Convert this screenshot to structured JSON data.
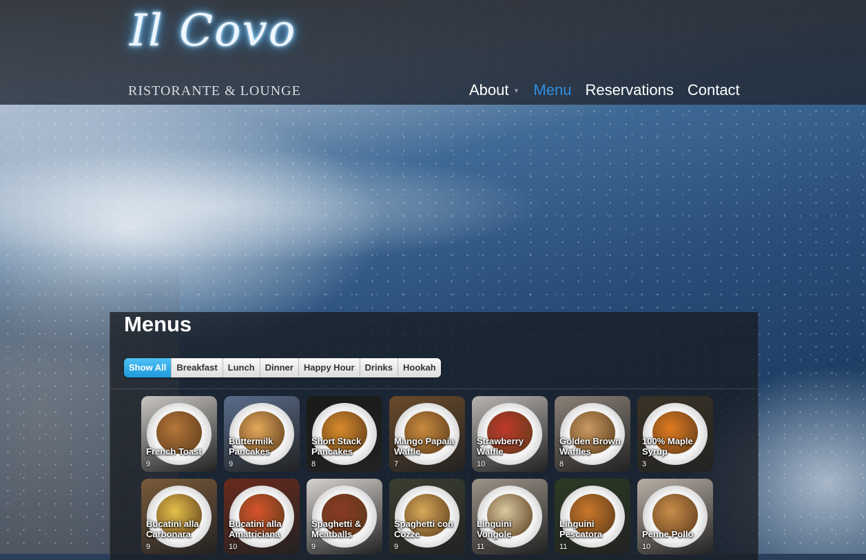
{
  "site": {
    "logo_script": "Il Covo",
    "logo_subtitle": "RISTORANTE & LOUNGE"
  },
  "nav": {
    "items": [
      {
        "label": "About",
        "has_dropdown": true,
        "active": false
      },
      {
        "label": "Menu",
        "has_dropdown": false,
        "active": true
      },
      {
        "label": "Reservations",
        "has_dropdown": false,
        "active": false
      },
      {
        "label": "Contact",
        "has_dropdown": false,
        "active": false
      }
    ]
  },
  "menus": {
    "title": "Menus",
    "filters": [
      "Show All",
      "Breakfast",
      "Lunch",
      "Dinner",
      "Happy Hour",
      "Drinks",
      "Hookah"
    ],
    "active_filter": "Show All",
    "items": [
      {
        "name": "French Toast",
        "count": "9",
        "bg": "#c9c6c2",
        "food": "#b5763a"
      },
      {
        "name": "Buttermilk Pancakes",
        "count": "9",
        "bg": "#5a6c8c",
        "food": "#e3a85a"
      },
      {
        "name": "Short Stack Pancakes",
        "count": "8",
        "bg": "#1a1a1a",
        "food": "#d98a2b"
      },
      {
        "name": "Mango Papaia Waffle",
        "count": "7",
        "bg": "#6a4a2a",
        "food": "#c88a3f"
      },
      {
        "name": "Strawberry Waffle",
        "count": "10",
        "bg": "#b8b4b0",
        "food": "#c0392b"
      },
      {
        "name": "Golden Brown Waffles",
        "count": "8",
        "bg": "#8a8077",
        "food": "#c99a62"
      },
      {
        "name": "100% Maple Syrup",
        "count": "3",
        "bg": "#3a3326",
        "food": "#e07a1f"
      },
      {
        "name": "Bucatini alla Carbonara",
        "count": "9",
        "bg": "#7a5a3a",
        "food": "#e6c14a"
      },
      {
        "name": "Bucatini alla Amatriciana",
        "count": "10",
        "bg": "#6a2a1e",
        "food": "#d8532c"
      },
      {
        "name": "Spaghetti & Meatballs",
        "count": "9",
        "bg": "#d6d2ce",
        "food": "#8a3a24"
      },
      {
        "name": "Spaghetti con Cozze",
        "count": "9",
        "bg": "#3a3f30",
        "food": "#d8a95a"
      },
      {
        "name": "Linguini Vongole",
        "count": "11",
        "bg": "#9c9388",
        "food": "#d8c8a0"
      },
      {
        "name": "Linguini Pescatora",
        "count": "11",
        "bg": "#2c3a24",
        "food": "#c9782a"
      },
      {
        "name": "Penne Pollo",
        "count": "10",
        "bg": "#b9b0a6",
        "food": "#c98d4a"
      }
    ]
  }
}
